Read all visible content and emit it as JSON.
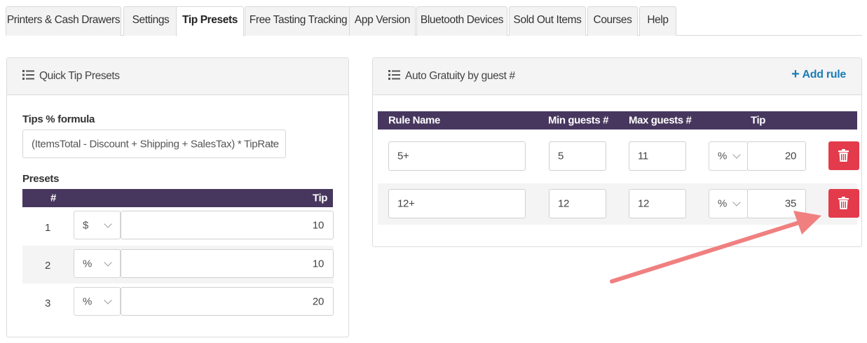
{
  "tabs": [
    {
      "label": "Printers & Cash Drawers",
      "active": false
    },
    {
      "label": "Settings",
      "active": false
    },
    {
      "label": "Tip Presets",
      "active": true
    },
    {
      "label": "Free Tasting Tracking",
      "active": false
    },
    {
      "label": "App Version",
      "active": false
    },
    {
      "label": "Bluetooth Devices",
      "active": false
    },
    {
      "label": "Sold Out Items",
      "active": false
    },
    {
      "label": "Courses",
      "active": false
    },
    {
      "label": "Help",
      "active": false
    }
  ],
  "quick_tip": {
    "title": "Quick Tip Presets",
    "formula_label": "Tips % formula",
    "formula_value": "(ItemsTotal - Discount + Shipping + SalesTax) * TipRate",
    "presets_label": "Presets",
    "columns": {
      "num": "#",
      "tip": "Tip"
    },
    "rows": [
      {
        "num": "1",
        "unit": "$",
        "tip": "10"
      },
      {
        "num": "2",
        "unit": "%",
        "tip": "10"
      },
      {
        "num": "3",
        "unit": "%",
        "tip": "20"
      }
    ]
  },
  "auto_gratuity": {
    "title": "Auto Gratuity by guest #",
    "add_rule": "Add rule",
    "columns": {
      "rule_name": "Rule Name",
      "min": "Min guests #",
      "max": "Max guests #",
      "tip": "Tip"
    },
    "rows": [
      {
        "name": "5+",
        "min": "5",
        "max": "11",
        "unit": "%",
        "tip": "20"
      },
      {
        "name": "12+",
        "min": "12",
        "max": "12",
        "unit": "%",
        "tip": "35"
      }
    ]
  },
  "colors": {
    "header_bg": "#47375e",
    "delete_button": "#e33b4b",
    "link_blue": "#1a7db5",
    "annotation_arrow": "#f08080"
  },
  "icons": {
    "list": "list-icon",
    "plus": "plus-icon",
    "trash": "trash-icon",
    "chevron": "chevron-down-icon"
  }
}
